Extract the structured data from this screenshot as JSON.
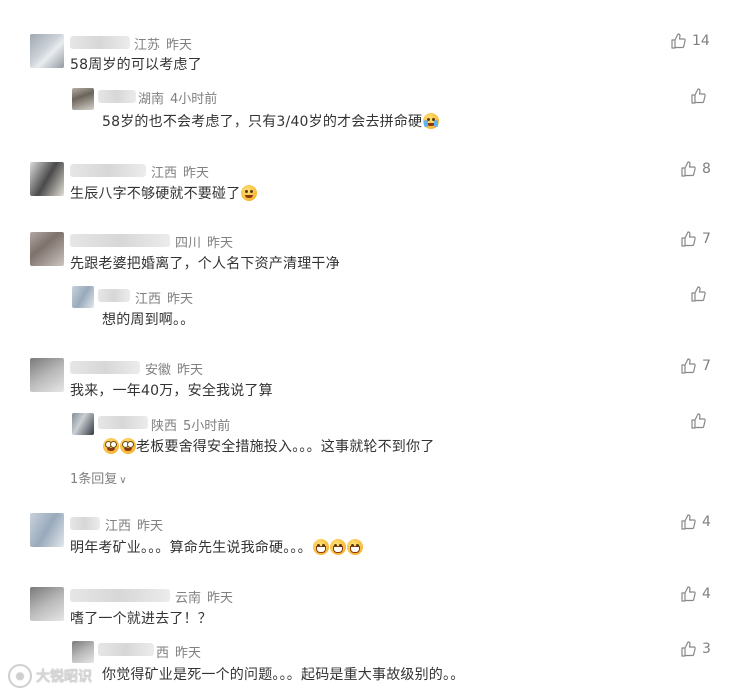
{
  "comments": [
    {
      "location": "江苏",
      "time": "昨天",
      "text": "58周岁的可以考虑了",
      "likes": "14",
      "reply": {
        "location": "湖南",
        "time": "4小时前",
        "text": "58岁的也不会考虑了，只有3/40岁的才会去拼命硬",
        "emoji": "crying-face"
      }
    },
    {
      "location": "江西",
      "time": "昨天",
      "text": "生辰八字不够硬就不要碰了",
      "emoji": "zany-face",
      "likes": "8"
    },
    {
      "location": "四川",
      "time": "昨天",
      "text": "先跟老婆把婚离了，个人名下资产清理干净",
      "likes": "7",
      "reply": {
        "location": "江西",
        "time": "昨天",
        "text": "想的周到啊。。"
      }
    },
    {
      "location": "安徽",
      "time": "昨天",
      "text": "我来，一年40万，安全我说了算",
      "likes": "7",
      "reply": {
        "location": "陕西",
        "time": "5小时前",
        "text": "老板要舍得安全措施投入。。。这事就轮不到你了",
        "emoji": "eye-roll-face"
      },
      "more_replies": "1条回复"
    },
    {
      "location": "江西",
      "time": "昨天",
      "text": "明年考矿业。。。算命先生说我命硬。。。",
      "emoji": "grinning-face",
      "likes": "4"
    },
    {
      "location": "云南",
      "time": "昨天",
      "text": "嗜了一个就进去了！？",
      "likes": "4",
      "reply": {
        "location": "西",
        "time": "昨天",
        "text": "你觉得矿业是死一个的问题。。。起码是重大事故级别的。。",
        "likes": "3"
      }
    }
  ],
  "watermark": "大锐昭识"
}
